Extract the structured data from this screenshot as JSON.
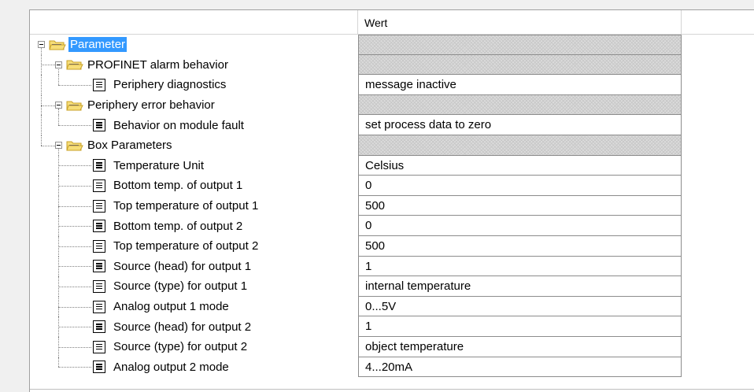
{
  "header": {
    "value_column": "Wert"
  },
  "tree": [
    {
      "level": 0,
      "type": "folder",
      "label": "Parameter",
      "value": "",
      "selected": true
    },
    {
      "level": 1,
      "type": "folder",
      "label": "PROFINET alarm behavior",
      "value": ""
    },
    {
      "level": 2,
      "type": "param",
      "label": "Periphery diagnostics",
      "value": "message inactive"
    },
    {
      "level": 1,
      "type": "folder",
      "label": "Periphery error behavior",
      "value": ""
    },
    {
      "level": 2,
      "type": "param",
      "label": "Behavior on module fault",
      "value": "set process data to zero"
    },
    {
      "level": 1,
      "type": "folder",
      "label": "Box Parameters",
      "value": ""
    },
    {
      "level": 2,
      "type": "param",
      "label": "Temperature Unit",
      "value": "Celsius"
    },
    {
      "level": 2,
      "type": "param",
      "label": "Bottom temp. of output 1",
      "value": "0"
    },
    {
      "level": 2,
      "type": "param",
      "label": "Top temperature of output 1",
      "value": "500"
    },
    {
      "level": 2,
      "type": "param",
      "label": "Bottom temp. of output 2",
      "value": "0"
    },
    {
      "level": 2,
      "type": "param",
      "label": "Top temperature of output 2",
      "value": "500"
    },
    {
      "level": 2,
      "type": "param",
      "label": "Source (head) for output 1",
      "value": "1"
    },
    {
      "level": 2,
      "type": "param",
      "label": "Source (type) for output 1",
      "value": "internal temperature"
    },
    {
      "level": 2,
      "type": "param",
      "label": "Analog output 1 mode",
      "value": "0...5V"
    },
    {
      "level": 2,
      "type": "param",
      "label": "Source (head) for output 2",
      "value": "1"
    },
    {
      "level": 2,
      "type": "param",
      "label": "Source (type) for output 2",
      "value": "object temperature"
    },
    {
      "level": 2,
      "type": "param",
      "label": "Analog output 2 mode",
      "value": "4...20mA"
    }
  ],
  "colors": {
    "selection": "#3399ff",
    "folder_fill": "#f6dd78",
    "folder_dark": "#c9a227",
    "folder_inner": "#2e3a8c"
  },
  "icons": {
    "folder": "folder-open-icon",
    "param": "document-lines-icon",
    "expander": "collapse-minus-icon"
  }
}
